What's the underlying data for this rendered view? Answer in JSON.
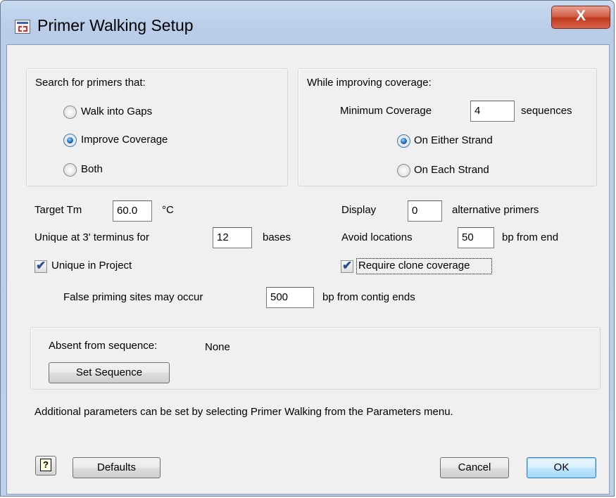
{
  "window": {
    "title": "Primer Walking Setup",
    "close_glyph": "X",
    "app_icon": "primer-walking-app-icon"
  },
  "search_group": {
    "label": "Search for primers that:",
    "options": [
      {
        "label": "Walk into Gaps",
        "selected": false
      },
      {
        "label": "Improve Coverage",
        "selected": true
      },
      {
        "label": "Both",
        "selected": false
      }
    ]
  },
  "coverage_group": {
    "label": "While improving coverage:",
    "min_coverage_label": "Minimum Coverage",
    "min_coverage_value": "4",
    "min_coverage_unit": "sequences",
    "options": [
      {
        "label": "On Either Strand",
        "selected": true
      },
      {
        "label": "On Each Strand",
        "selected": false
      }
    ]
  },
  "params": {
    "target_tm_label": "Target Tm",
    "target_tm_value": "60.0",
    "target_tm_unit": "°C",
    "display_label": "Display",
    "display_value": "0",
    "display_unit": "alternative primers",
    "unique3_label": "Unique at 3' terminus for",
    "unique3_value": "12",
    "unique3_unit": "bases",
    "avoid_label": "Avoid locations",
    "avoid_value": "50",
    "avoid_unit": "bp from end",
    "unique_project_label": "Unique in Project",
    "unique_project_checked": true,
    "clone_coverage_label": "Require clone coverage",
    "clone_coverage_checked": true,
    "false_priming_label": "False priming sites may occur",
    "false_priming_value": "500",
    "false_priming_unit": "bp from contig ends"
  },
  "absent": {
    "label": "Absent from sequence:",
    "value": "None",
    "button": "Set Sequence"
  },
  "info_text": "Additional parameters can be set by selecting Primer Walking from the Parameters menu.",
  "footer": {
    "help_glyph": "?",
    "defaults": "Defaults",
    "cancel": "Cancel",
    "ok": "OK"
  },
  "check_glyph": "✔"
}
